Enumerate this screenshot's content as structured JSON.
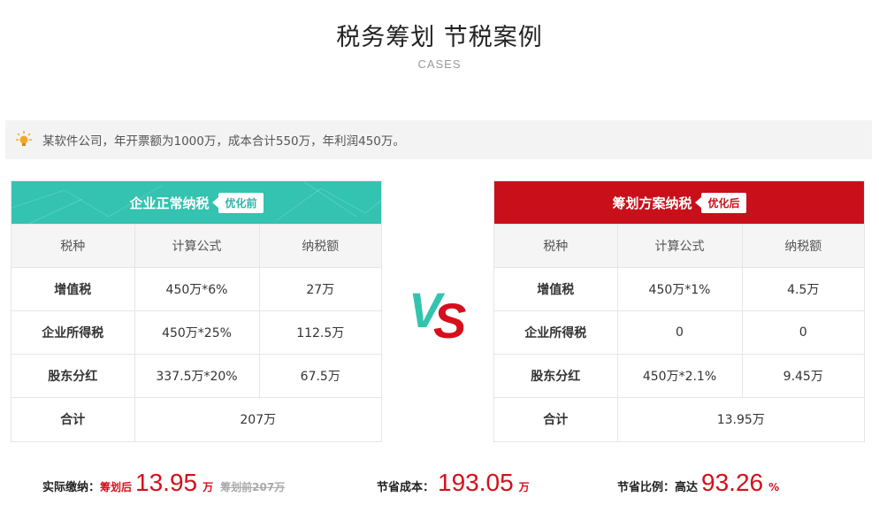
{
  "header": {
    "title": "税务筹划 节税案例",
    "subtitle": "CASES"
  },
  "case": {
    "icon": "lightbulb-icon",
    "text": "某软件公司，年开票额为1000万，成本合计550万，年利润450万。"
  },
  "colors": {
    "teal": "#33c3b0",
    "red": "#c9101a"
  },
  "before": {
    "title": "企业正常纳税",
    "tag": "优化前",
    "headers": [
      "税种",
      "计算公式",
      "纳税额"
    ],
    "rows": [
      [
        "增值税",
        "450万*6%",
        "27万"
      ],
      [
        "企业所得税",
        "450万*25%",
        "112.5万"
      ],
      [
        "股东分红",
        "337.5万*20%",
        "67.5万"
      ]
    ],
    "total_label": "合计",
    "total_value": "207万"
  },
  "after": {
    "title": "筹划方案纳税",
    "tag": "优化后",
    "headers": [
      "税种",
      "计算公式",
      "纳税额"
    ],
    "rows": [
      [
        "增值税",
        "450万*1%",
        "4.5万"
      ],
      [
        "企业所得税",
        "0",
        "0"
      ],
      [
        "股东分红",
        "450万*2.1%",
        "9.45万"
      ]
    ],
    "total_label": "合计",
    "total_value": "13.95万"
  },
  "vs": {
    "v": "V",
    "s": "S"
  },
  "summary": {
    "actual_label": "实际缴纳：",
    "actual_prefix": "筹划后",
    "actual_value": "13.95",
    "actual_unit": "万",
    "actual_before": "筹划前207万",
    "save_label": "节省成本：",
    "save_value": "193.05",
    "save_unit": "万",
    "ratio_label": "节省比例：",
    "ratio_prefix": "高达",
    "ratio_value": "93.26",
    "ratio_unit": "%"
  }
}
